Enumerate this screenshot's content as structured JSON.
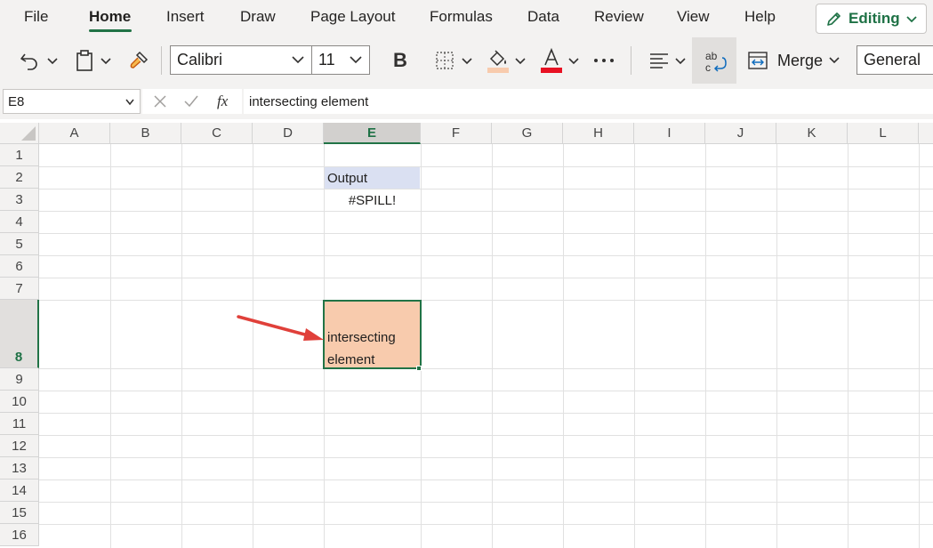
{
  "menu": {
    "items": [
      "File",
      "Home",
      "Insert",
      "Draw",
      "Page Layout",
      "Formulas",
      "Data",
      "Review",
      "View",
      "Help"
    ],
    "active": "Home",
    "editing_label": "Editing"
  },
  "ribbon": {
    "font_name": "Calibri",
    "font_size": "11",
    "bold_label": "B",
    "merge_label": "Merge",
    "number_format": "General",
    "font_color": "#e81123",
    "fill_color": "#f8cbad"
  },
  "formula_bar": {
    "name_box": "E8",
    "fx_label": "fx",
    "formula": "intersecting element"
  },
  "sheet": {
    "columns": [
      "A",
      "B",
      "C",
      "D",
      "E",
      "F",
      "G",
      "H",
      "I",
      "J",
      "K",
      "L"
    ],
    "rows": [
      "1",
      "2",
      "3",
      "4",
      "5",
      "6",
      "7",
      "8",
      "9",
      "10",
      "11",
      "12",
      "13",
      "14",
      "15",
      "16"
    ],
    "selected_column": "E",
    "selected_row": "8",
    "cells": {
      "E2": "Output",
      "E3": "#SPILL!",
      "E8_line1": "intersecting",
      "E8_line2": "element"
    }
  }
}
